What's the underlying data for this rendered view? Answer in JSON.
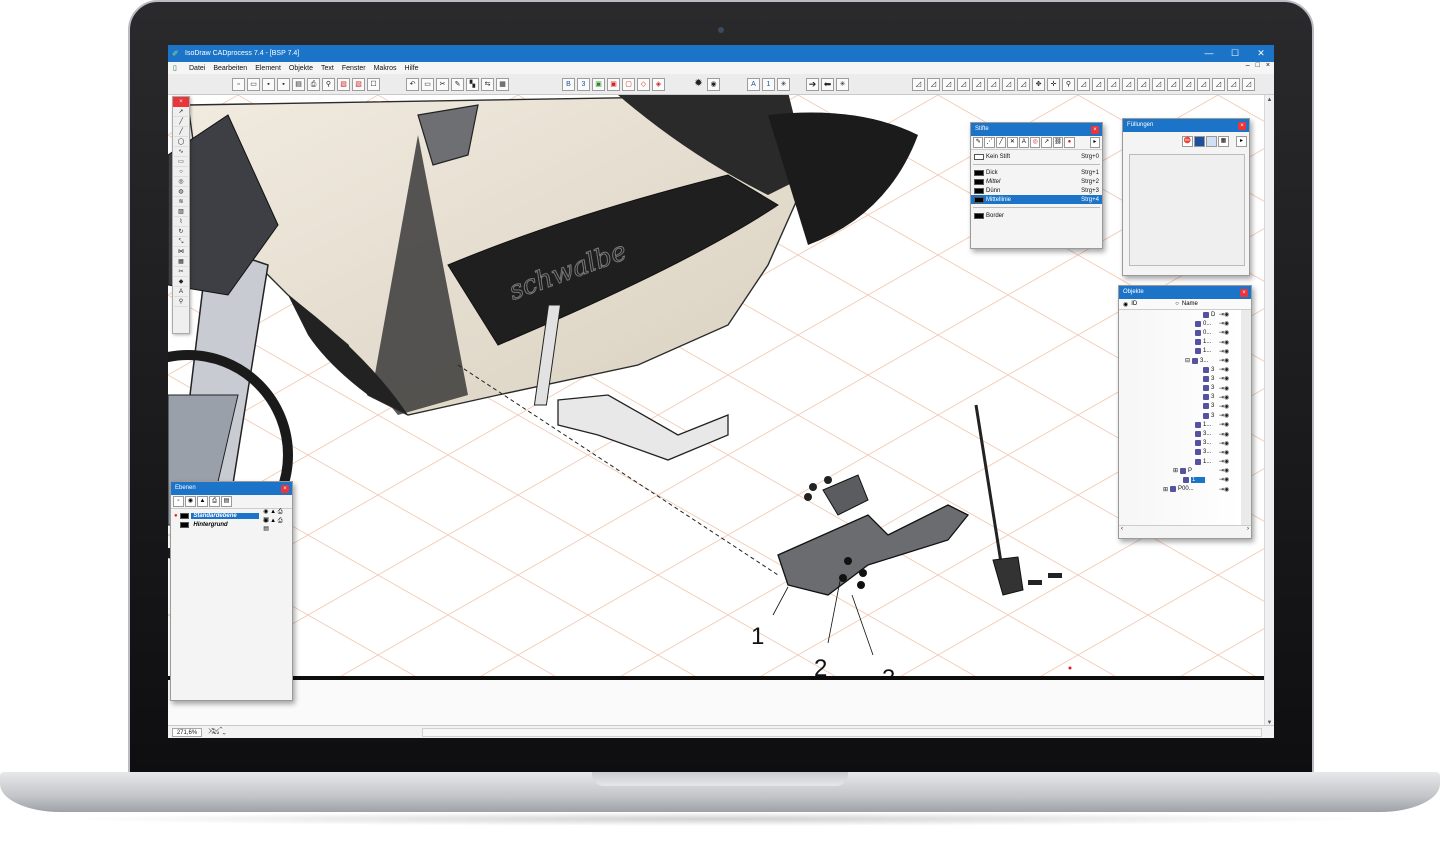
{
  "window": {
    "title": "IsoDraw CADprocess 7.4 - [BSP 7.4]",
    "minimize": "—",
    "maximize": "☐",
    "close": "✕"
  },
  "menu": {
    "items": [
      "Datei",
      "Bearbeiten",
      "Element",
      "Objekte",
      "Text",
      "Fenster",
      "Makros",
      "Hilfe"
    ],
    "mdi_buttons": [
      "–",
      "□",
      "×"
    ]
  },
  "toolbar": {
    "text_buttons": [
      "B",
      "3",
      "A",
      "1"
    ]
  },
  "status": {
    "zoom": "271,6%"
  },
  "panels": {
    "stifte": {
      "title": "Stifte",
      "none_pen": {
        "name": "Kein Stift",
        "shortcut": "Strg+0"
      },
      "pens": [
        {
          "name": "Dick",
          "shortcut": "Strg+1",
          "selected": false
        },
        {
          "name": "Mittel",
          "shortcut": "Strg+2",
          "selected": false
        },
        {
          "name": "Dünn",
          "shortcut": "Strg+3",
          "selected": false
        },
        {
          "name": "Mittellinie",
          "shortcut": "Strg+4",
          "selected": true
        }
      ],
      "extra_pen": {
        "name": "Border"
      }
    },
    "fuellungen": {
      "title": "Füllungen"
    },
    "objekte": {
      "title": "Objekte",
      "col_id": "ID",
      "col_name": "Name",
      "rows": [
        "D",
        "0...",
        "0...",
        "1...",
        "1...",
        "3...",
        "3",
        "3",
        "3",
        "3",
        "3",
        "3",
        "1...",
        "3...",
        "3...",
        "3...",
        "1...",
        "P",
        "1",
        "P00..."
      ]
    },
    "ebenen": {
      "title": "Ebenen",
      "layers": [
        {
          "name": "Standardebene",
          "selected": true
        },
        {
          "name": "Hintergrund",
          "selected": false
        }
      ]
    }
  },
  "callouts": [
    "1",
    "2",
    "3"
  ],
  "colors": {
    "title_bar": "#1c74c8",
    "grid": "#f2c7b0",
    "scooter_body": "#e9e1d2",
    "close_button": "#e8363a"
  }
}
